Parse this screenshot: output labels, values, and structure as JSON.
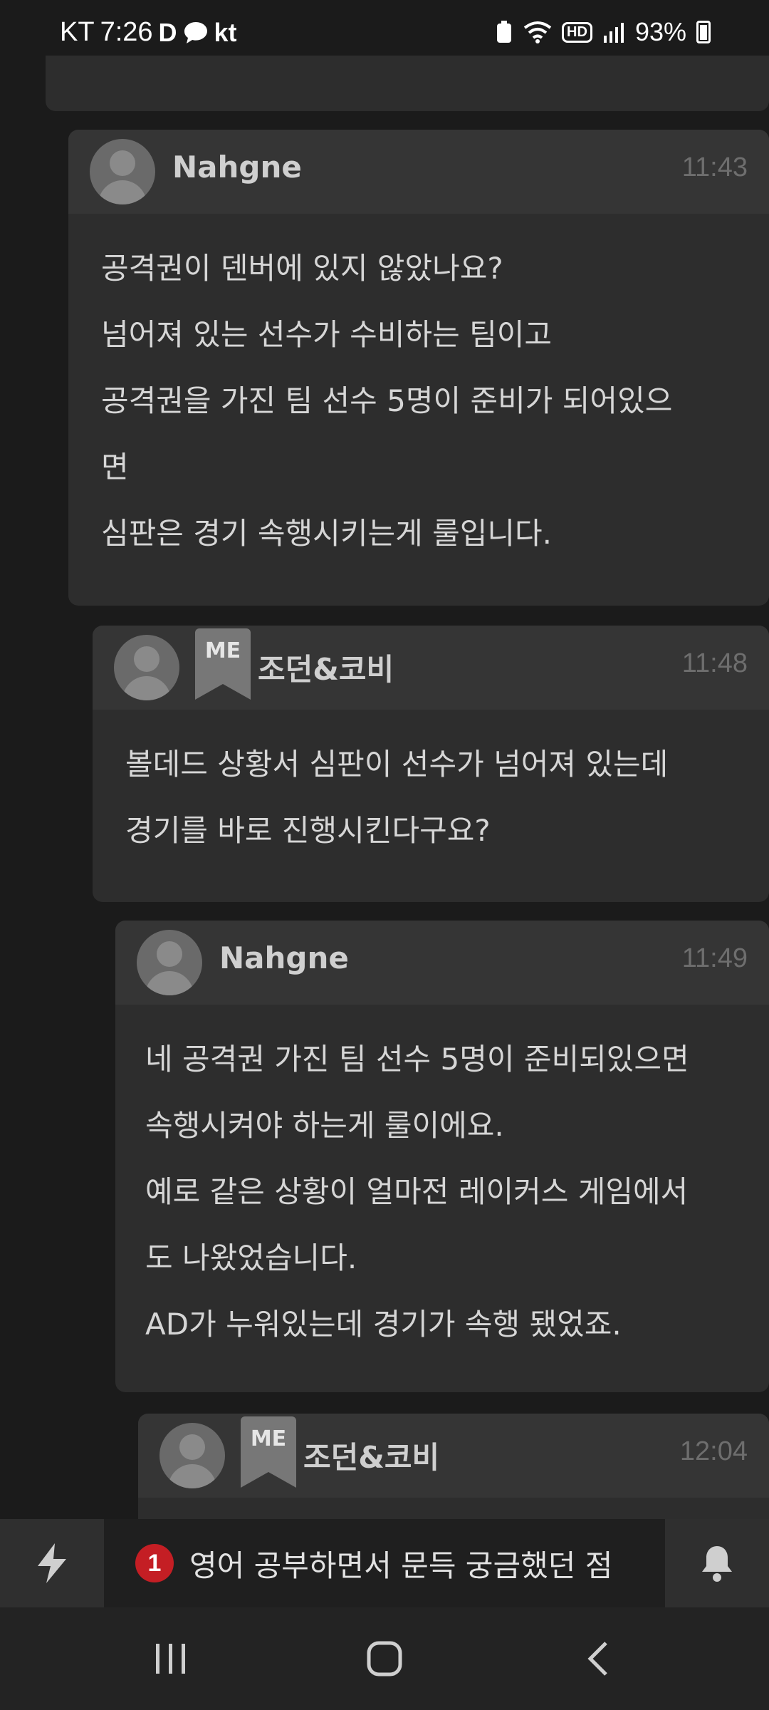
{
  "status_bar": {
    "carrier": "KT",
    "time": "7:26",
    "app_icons": [
      "D",
      "kt"
    ],
    "battery": "93%"
  },
  "comments": [
    {
      "author": "Nahgne",
      "time": "11:43",
      "is_me": false,
      "lines": [
        "공격권이 덴버에 있지 않았나요?",
        "넘어져 있는 선수가 수비하는 팀이고",
        "공격권을 가진 팀 선수 5명이 준비가 되어있으",
        "면",
        "심판은 경기 속행시키는게 룰입니다."
      ]
    },
    {
      "author": "조던&코비",
      "time": "11:48",
      "is_me": true,
      "badge": "ME",
      "lines": [
        "볼데드 상황서 심판이 선수가 넘어져 있는데",
        "경기를 바로 진행시킨다구요?"
      ]
    },
    {
      "author": "Nahgne",
      "time": "11:49",
      "is_me": false,
      "lines": [
        "네 공격권 가진 팀 선수 5명이 준비되있으면",
        "속행시켜야 하는게 룰이에요.",
        "예로 같은 상황이 얼마전 레이커스 게임에서",
        "도 나왔었습니다.",
        "AD가 누워있는데 경기가 속행 됐었죠."
      ]
    },
    {
      "author": "조던&코비",
      "time": "12:04",
      "is_me": true,
      "badge": "ME",
      "lines": []
    }
  ],
  "ticker": {
    "count": "1",
    "text": "영어 공부하면서 문득 궁금했던 점"
  },
  "icons": {
    "flash": "lightning-icon",
    "bell": "bell-icon",
    "recents": "recents-icon",
    "home": "home-icon",
    "back": "back-icon"
  }
}
